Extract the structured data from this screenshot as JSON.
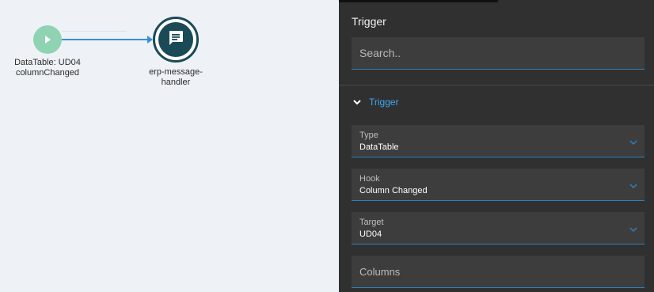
{
  "canvas": {
    "trigger_node": {
      "label": "DataTable: UD04 columnChanged",
      "icon": "play-icon",
      "color": "#8fd3b3"
    },
    "handler_node": {
      "label": "erp-message-handler",
      "icon": "message-icon",
      "color": "#1b4a57"
    },
    "edge_color": "#3b8fd9"
  },
  "panel": {
    "title": "Trigger",
    "search": {
      "placeholder": "Search..",
      "value": ""
    },
    "section": {
      "title": "Trigger",
      "expanded": true
    },
    "fields": {
      "type": {
        "label": "Type",
        "value": "DataTable"
      },
      "hook": {
        "label": "Hook",
        "value": "Column Changed"
      },
      "target": {
        "label": "Target",
        "value": "UD04"
      },
      "columns": {
        "placeholder": "Columns"
      }
    },
    "accent_color": "#3fa9f5"
  }
}
